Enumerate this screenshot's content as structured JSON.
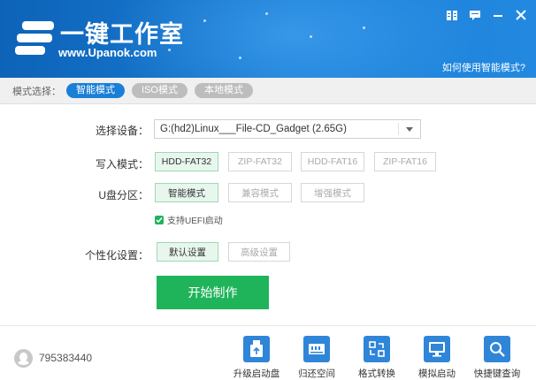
{
  "header": {
    "logo_title": "一键工作室",
    "logo_url": "www.Upanok.com",
    "help_link": "如何使用智能模式?"
  },
  "mode_bar": {
    "label": "模式选择：",
    "modes": [
      {
        "label": "智能模式",
        "active": true
      },
      {
        "label": "ISO模式",
        "active": false
      },
      {
        "label": "本地模式",
        "active": false
      }
    ]
  },
  "form": {
    "device": {
      "label": "选择设备：",
      "value": "G:(hd2)Linux___File-CD_Gadget (2.65G)"
    },
    "write_mode": {
      "label": "写入模式：",
      "options": [
        "HDD-FAT32",
        "ZIP-FAT32",
        "HDD-FAT16",
        "ZIP-FAT16"
      ],
      "selected": "HDD-FAT32"
    },
    "partition": {
      "label": "U盘分区：",
      "options": [
        "智能模式",
        "兼容模式",
        "增强模式"
      ],
      "selected": "智能模式"
    },
    "uefi": {
      "label": "支持UEFI启动",
      "checked": true
    },
    "personal": {
      "label": "个性化设置：",
      "options": [
        "默认设置",
        "高级设置"
      ],
      "selected": "默认设置"
    },
    "start_button": "开始制作"
  },
  "footer": {
    "qq_number": "795383440",
    "tools": [
      {
        "label": "升级启动盘",
        "icon": "usb-upgrade-icon"
      },
      {
        "label": "归还空间",
        "icon": "restore-space-icon"
      },
      {
        "label": "格式转换",
        "icon": "format-convert-icon"
      },
      {
        "label": "模拟启动",
        "icon": "monitor-icon"
      },
      {
        "label": "快捷键查询",
        "icon": "search-icon"
      }
    ]
  },
  "colors": {
    "header_blue": "#1a7fd6",
    "accent_green": "#20b45a",
    "tool_blue": "#2f86d8"
  }
}
